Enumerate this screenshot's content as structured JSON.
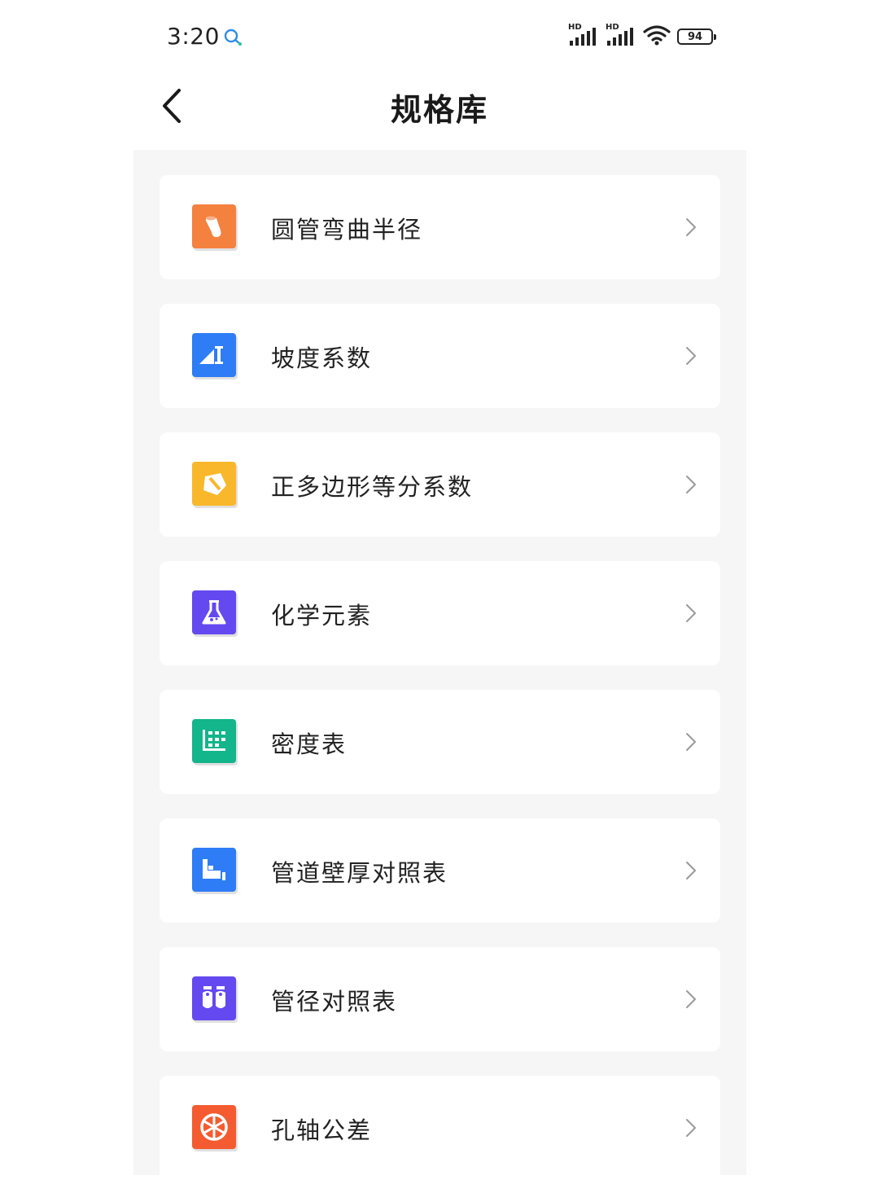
{
  "status_bar": {
    "time": "3:20",
    "signal_1_label": "HD",
    "signal_2_label": "HD",
    "battery_level": "94"
  },
  "header": {
    "title": "规格库",
    "back_icon": "chevron-left-icon"
  },
  "items": [
    {
      "label": "圆管弯曲半径",
      "icon": "bent-pipe-icon",
      "color": "#F5813F"
    },
    {
      "label": "坡度系数",
      "icon": "slope-icon",
      "color": "#2E7CF6"
    },
    {
      "label": "正多边形等分系数",
      "icon": "polygon-icon",
      "color": "#F9B72B"
    },
    {
      "label": "化学元素",
      "icon": "flask-icon",
      "color": "#6549F0"
    },
    {
      "label": "密度表",
      "icon": "grid-table-icon",
      "color": "#13B58A"
    },
    {
      "label": "管道壁厚对照表",
      "icon": "pipe-wall-icon",
      "color": "#2E7CF6"
    },
    {
      "label": "管径对照表",
      "icon": "pipe-diameter-icon",
      "color": "#6549F0"
    },
    {
      "label": "孔轴公差",
      "icon": "wheel-icon",
      "color": "#F45B30"
    }
  ]
}
